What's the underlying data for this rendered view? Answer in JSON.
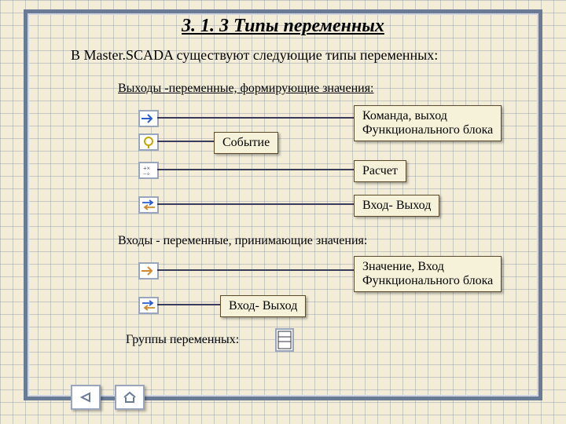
{
  "title": "3. 1. 3 Типы переменных",
  "subtitle": "В Master.SCADA существуют следующие типы переменных:",
  "sections": {
    "outputs": "Выходы  -переменные, формирующие значения:",
    "inputs": "Входы - переменные, принимающие значения:",
    "groups": "Группы переменных:"
  },
  "boxes": {
    "event": "Событие",
    "command": "Команда, выход\nФункционального блока",
    "calc": "Расчет",
    "io1": "Вход- Выход",
    "io2": "Вход- Выход",
    "value": "Значение, Вход\nФункционального блока"
  },
  "icons": {
    "out1": "arrow-right-blue",
    "out2": "lightbulb",
    "out3": "calc",
    "out4": "bidir",
    "in1": "arrow-right-orange",
    "in2": "bidir",
    "group": "group-icon"
  }
}
